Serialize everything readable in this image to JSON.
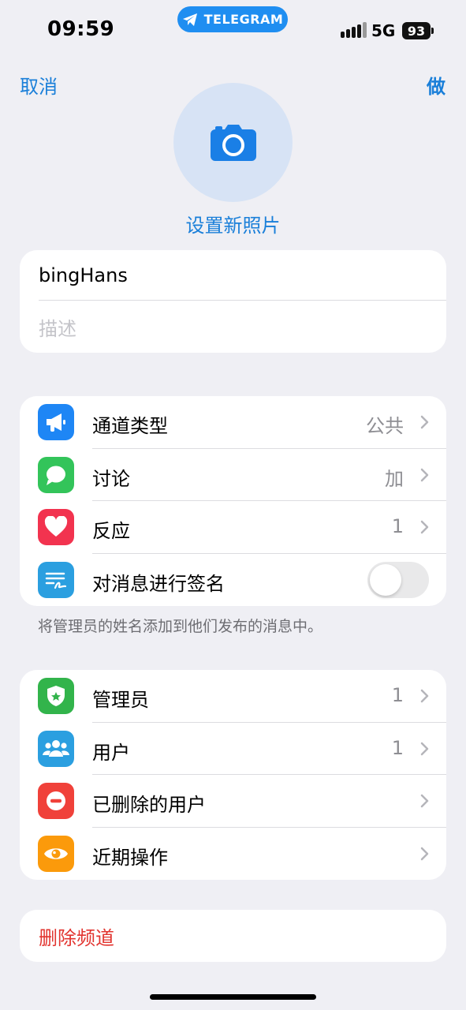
{
  "status": {
    "time": "09:59",
    "pill_label": "TELEGRAM",
    "network": "5G",
    "battery": "93"
  },
  "nav": {
    "cancel": "取消",
    "done": "做"
  },
  "photo": {
    "label": "设置新照片"
  },
  "channel": {
    "name": "bingHans",
    "description_placeholder": "描述"
  },
  "settings": [
    {
      "label": "通道类型",
      "value": "公共",
      "icon": "megaphone-icon",
      "color": "#1e86f5"
    },
    {
      "label": "讨论",
      "value": "加",
      "icon": "chat-bubble-icon",
      "color": "#33c45a"
    },
    {
      "label": "反应",
      "value": "1",
      "icon": "heart-icon",
      "color": "#f2334f"
    },
    {
      "label": "对消息进行签名",
      "value": "",
      "icon": "signature-icon",
      "color": "#2b9fe0",
      "toggle": false
    }
  ],
  "settings_footnote": "将管理员的姓名添加到他们发布的消息中。",
  "management": [
    {
      "label": "管理员",
      "value": "1",
      "icon": "admin-shield-icon",
      "color": "#32b44b"
    },
    {
      "label": "用户",
      "value": "1",
      "icon": "users-icon",
      "color": "#2b9fe0"
    },
    {
      "label": "已删除的用户",
      "value": "",
      "icon": "minus-circle-icon",
      "color": "#f0413a"
    },
    {
      "label": "近期操作",
      "value": "",
      "icon": "eye-icon",
      "color": "#fb9a0b"
    }
  ],
  "delete_channel": "删除频道"
}
